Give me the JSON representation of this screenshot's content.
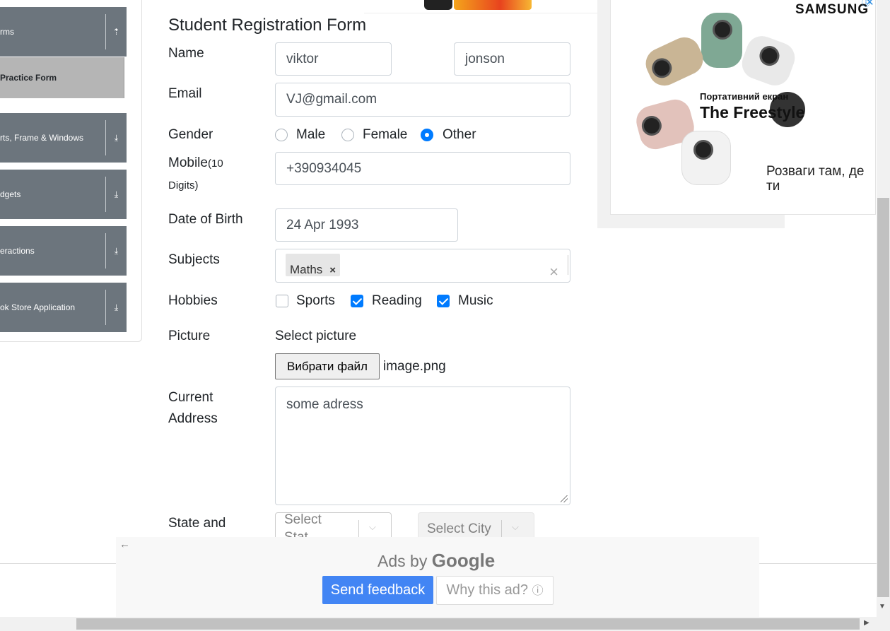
{
  "sidebar": {
    "groups": [
      {
        "label": "rms"
      },
      {
        "label": "rts, Frame & Windows"
      },
      {
        "label": "dgets"
      },
      {
        "label": "eractions"
      },
      {
        "label": "ok Store Application"
      }
    ],
    "active_item": "Practice Form"
  },
  "form": {
    "title": "Student Registration Form",
    "labels": {
      "name": "Name",
      "email": "Email",
      "gender": "Gender",
      "mobile": "Mobile",
      "mobile_hint": "(10",
      "mobile_hint2": "Digits)",
      "dob": "Date of Birth",
      "subjects": "Subjects",
      "hobbies": "Hobbies",
      "picture": "Picture",
      "address1": "Current",
      "address2": "Address",
      "state": "State and"
    },
    "first_name": "viktor",
    "last_name": "jonson",
    "email": "VJ@gmail.com",
    "gender_options": [
      {
        "label": "Male",
        "checked": false
      },
      {
        "label": "Female",
        "checked": false
      },
      {
        "label": "Other",
        "checked": true
      }
    ],
    "mobile": "+390934045",
    "dob": "24 Apr 1993",
    "subject_chip": "Maths",
    "hobby_options": [
      {
        "label": "Sports",
        "checked": false
      },
      {
        "label": "Reading",
        "checked": true
      },
      {
        "label": "Music",
        "checked": true
      }
    ],
    "picture_caption": "Select picture",
    "file_button": "Вибрати файл",
    "file_name": "image.png",
    "address": "some adress",
    "state_placeholder": "Select\nState",
    "state_line1": "Select",
    "state_line2": "Stat",
    "city_placeholder": "Select City"
  },
  "right_ad": {
    "brand": "SAMSUNG",
    "line1": "Портативний екран",
    "line2": "The Freestyle",
    "line3": "Розваги там, де ти"
  },
  "google_ad": {
    "ads_by": "Ads by",
    "google": "Google",
    "send_feedback": "Send feedback",
    "why_this_ad": "Why this ad?"
  },
  "colors": {
    "accent": "#007bff",
    "sidebar_group": "#6c757d",
    "google_blue": "#4285f4"
  }
}
